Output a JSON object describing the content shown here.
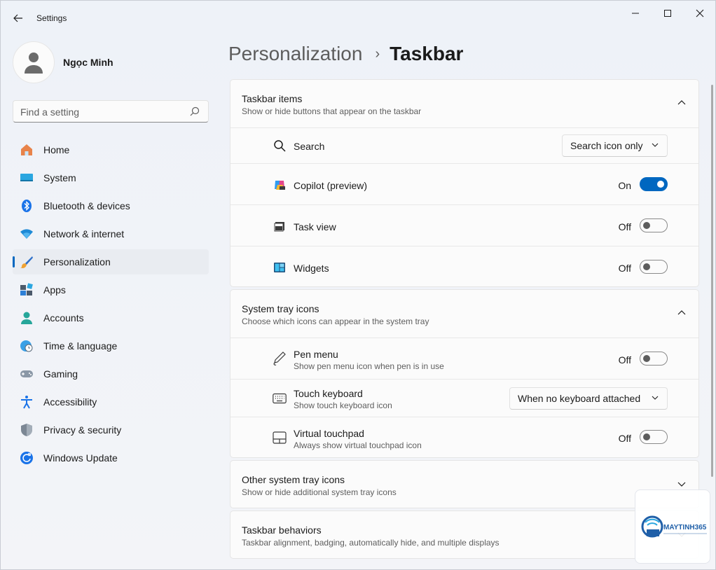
{
  "window": {
    "title": "Settings"
  },
  "user": {
    "name": "Ngọc Minh"
  },
  "search": {
    "placeholder": "Find a setting"
  },
  "nav": [
    {
      "label": "Home",
      "icon": "home-icon"
    },
    {
      "label": "System",
      "icon": "system-icon"
    },
    {
      "label": "Bluetooth & devices",
      "icon": "bluetooth-icon"
    },
    {
      "label": "Network & internet",
      "icon": "wifi-icon"
    },
    {
      "label": "Personalization",
      "icon": "brush-icon",
      "active": true
    },
    {
      "label": "Apps",
      "icon": "apps-icon"
    },
    {
      "label": "Accounts",
      "icon": "account-icon"
    },
    {
      "label": "Time & language",
      "icon": "globe-clock-icon"
    },
    {
      "label": "Gaming",
      "icon": "gamepad-icon"
    },
    {
      "label": "Accessibility",
      "icon": "accessibility-icon"
    },
    {
      "label": "Privacy & security",
      "icon": "shield-icon"
    },
    {
      "label": "Windows Update",
      "icon": "update-icon"
    }
  ],
  "breadcrumb": {
    "parent": "Personalization",
    "separator": "›",
    "current": "Taskbar"
  },
  "taskbar_items": {
    "title": "Taskbar items",
    "desc": "Show or hide buttons that appear on the taskbar",
    "search": {
      "label": "Search",
      "value": "Search icon only"
    },
    "copilot": {
      "label": "Copilot (preview)",
      "state": "On"
    },
    "task_view": {
      "label": "Task view",
      "state": "Off"
    },
    "widgets": {
      "label": "Widgets",
      "state": "Off"
    }
  },
  "system_tray": {
    "title": "System tray icons",
    "desc": "Choose which icons can appear in the system tray",
    "pen_menu": {
      "label": "Pen menu",
      "desc": "Show pen menu icon when pen is in use",
      "state": "Off"
    },
    "touch_keyboard": {
      "label": "Touch keyboard",
      "desc": "Show touch keyboard icon",
      "value": "When no keyboard attached"
    },
    "virtual_touchpad": {
      "label": "Virtual touchpad",
      "desc": "Always show virtual touchpad icon",
      "state": "Off"
    }
  },
  "other_tray": {
    "title": "Other system tray icons",
    "desc": "Show or hide additional system tray icons"
  },
  "behaviors": {
    "title": "Taskbar behaviors",
    "desc": "Taskbar alignment, badging, automatically hide, and multiple displays"
  },
  "watermark": {
    "brand": "MAYTINH365"
  },
  "colors": {
    "accent": "#0067c0",
    "background": "#f1f4f9",
    "card": "#fbfbfb"
  }
}
